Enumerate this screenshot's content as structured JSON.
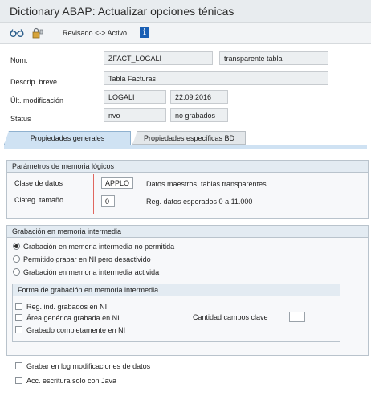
{
  "window": {
    "title": "Dictionary ABAP: Actualizar opciones ténicas"
  },
  "toolbar": {
    "toggle_label": "Revisado <-> Activo",
    "icons": [
      "glasses-icon",
      "lock-key-icon",
      "info-icon"
    ]
  },
  "header": {
    "nom_label": "Nom.",
    "nom_value": "ZFACT_LOGALI",
    "type_value": "transparente tabla",
    "descrip_label": "Descrip. breve",
    "descrip_value": "Tabla Facturas",
    "ult_label": "Últ. modificación",
    "ult_user": "LOGALI",
    "ult_date": "22.09.2016",
    "status_label": "Status",
    "status_value": "nvo",
    "status_saved": "no grabados"
  },
  "tabs": [
    {
      "label": "Propiedades generales",
      "active": true
    },
    {
      "label": "Propiedades específicas BD",
      "active": false
    }
  ],
  "logical_params": {
    "title": "Parámetros de memoria lógicos",
    "clase_label": "Clase de datos",
    "clase_value": "APPLO",
    "clase_desc": "Datos maestros, tablas transparentes",
    "categ_label": "Clateg. tamaño",
    "categ_value": "0",
    "categ_desc": "Reg. datos esperados 0 a 11.000"
  },
  "buffering": {
    "title": "Grabación en memoria intermedia",
    "options": [
      {
        "label": "Grabación en memoria intermedia no permitida",
        "selected": true
      },
      {
        "label": "Permitido grabar en NI pero desactivido",
        "selected": false
      },
      {
        "label": "Grabación en memoria intermedia activida",
        "selected": false
      }
    ],
    "form_title": "Forma de grabación en memoria intermedia",
    "form_options": [
      "Reg. ind. grabados en NI",
      "Área genérica grabada en NI",
      "Grabado completamente en NI"
    ],
    "key_count_label": "Cantidad campos clave",
    "key_count_value": ""
  },
  "bottom_options": [
    "Grabar en log modificaciones de datos",
    "Acc. escritura solo con Java"
  ],
  "colors": {
    "tab_active": "#cfe2f3",
    "highlight": "#e0675f",
    "info": "#1a5fb4"
  }
}
